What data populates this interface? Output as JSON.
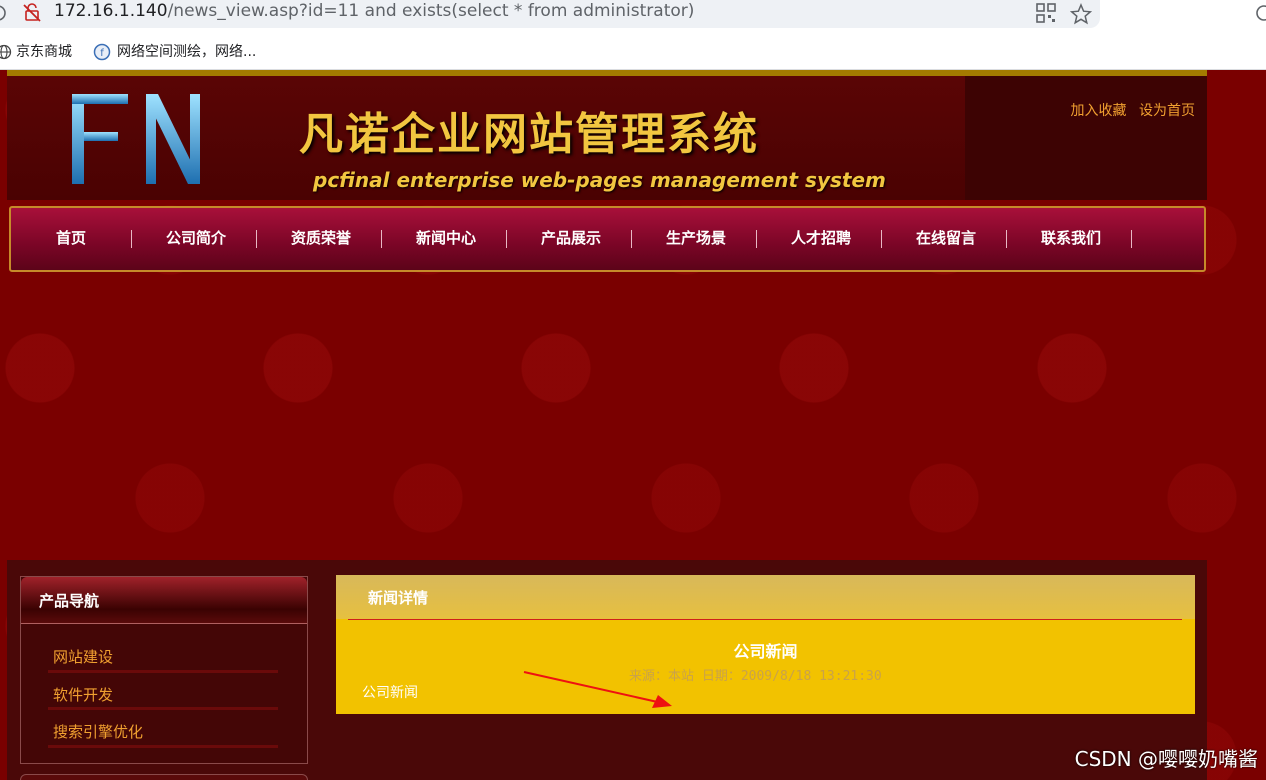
{
  "browser": {
    "url_host": "172.16.1.140",
    "url_path": "/news_view.asp?id=11 and exists(select * from administrator)",
    "bookmarks": [
      "京东商城",
      "网络空间测绘，网络..."
    ]
  },
  "site": {
    "logo_text": "FN",
    "title": "凡诺企业网站管理系统",
    "subtitle": "pcfinal enterprise web-pages management system",
    "toplinks": [
      "加入收藏",
      "设为首页"
    ],
    "nav": [
      "首页",
      "公司简介",
      "资质荣誉",
      "新闻中心",
      "产品展示",
      "生产场景",
      "人才招聘",
      "在线留言",
      "联系我们"
    ]
  },
  "sidebar": {
    "title": "产品导航",
    "links": [
      "网站建设",
      "软件开发",
      "搜索引擎优化"
    ]
  },
  "news": {
    "header": "新闻详情",
    "title": "公司新闻",
    "meta": "来源：本站 日期：2009/8/18 13:21:30",
    "body": "公司新闻"
  },
  "watermark": "CSDN @嘤嘤奶嘴酱"
}
